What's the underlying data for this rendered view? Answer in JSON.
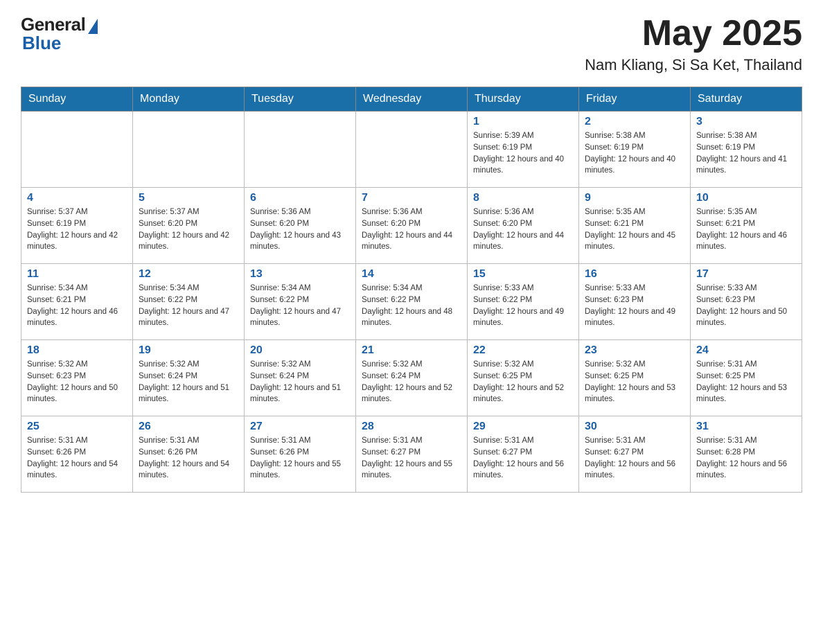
{
  "header": {
    "logo_general": "General",
    "logo_blue": "Blue",
    "month_year": "May 2025",
    "location": "Nam Kliang, Si Sa Ket, Thailand"
  },
  "days_of_week": [
    "Sunday",
    "Monday",
    "Tuesday",
    "Wednesday",
    "Thursday",
    "Friday",
    "Saturday"
  ],
  "weeks": [
    [
      {
        "day": "",
        "sunrise": "",
        "sunset": "",
        "daylight": ""
      },
      {
        "day": "",
        "sunrise": "",
        "sunset": "",
        "daylight": ""
      },
      {
        "day": "",
        "sunrise": "",
        "sunset": "",
        "daylight": ""
      },
      {
        "day": "",
        "sunrise": "",
        "sunset": "",
        "daylight": ""
      },
      {
        "day": "1",
        "sunrise": "Sunrise: 5:39 AM",
        "sunset": "Sunset: 6:19 PM",
        "daylight": "Daylight: 12 hours and 40 minutes."
      },
      {
        "day": "2",
        "sunrise": "Sunrise: 5:38 AM",
        "sunset": "Sunset: 6:19 PM",
        "daylight": "Daylight: 12 hours and 40 minutes."
      },
      {
        "day": "3",
        "sunrise": "Sunrise: 5:38 AM",
        "sunset": "Sunset: 6:19 PM",
        "daylight": "Daylight: 12 hours and 41 minutes."
      }
    ],
    [
      {
        "day": "4",
        "sunrise": "Sunrise: 5:37 AM",
        "sunset": "Sunset: 6:19 PM",
        "daylight": "Daylight: 12 hours and 42 minutes."
      },
      {
        "day": "5",
        "sunrise": "Sunrise: 5:37 AM",
        "sunset": "Sunset: 6:20 PM",
        "daylight": "Daylight: 12 hours and 42 minutes."
      },
      {
        "day": "6",
        "sunrise": "Sunrise: 5:36 AM",
        "sunset": "Sunset: 6:20 PM",
        "daylight": "Daylight: 12 hours and 43 minutes."
      },
      {
        "day": "7",
        "sunrise": "Sunrise: 5:36 AM",
        "sunset": "Sunset: 6:20 PM",
        "daylight": "Daylight: 12 hours and 44 minutes."
      },
      {
        "day": "8",
        "sunrise": "Sunrise: 5:36 AM",
        "sunset": "Sunset: 6:20 PM",
        "daylight": "Daylight: 12 hours and 44 minutes."
      },
      {
        "day": "9",
        "sunrise": "Sunrise: 5:35 AM",
        "sunset": "Sunset: 6:21 PM",
        "daylight": "Daylight: 12 hours and 45 minutes."
      },
      {
        "day": "10",
        "sunrise": "Sunrise: 5:35 AM",
        "sunset": "Sunset: 6:21 PM",
        "daylight": "Daylight: 12 hours and 46 minutes."
      }
    ],
    [
      {
        "day": "11",
        "sunrise": "Sunrise: 5:34 AM",
        "sunset": "Sunset: 6:21 PM",
        "daylight": "Daylight: 12 hours and 46 minutes."
      },
      {
        "day": "12",
        "sunrise": "Sunrise: 5:34 AM",
        "sunset": "Sunset: 6:22 PM",
        "daylight": "Daylight: 12 hours and 47 minutes."
      },
      {
        "day": "13",
        "sunrise": "Sunrise: 5:34 AM",
        "sunset": "Sunset: 6:22 PM",
        "daylight": "Daylight: 12 hours and 47 minutes."
      },
      {
        "day": "14",
        "sunrise": "Sunrise: 5:34 AM",
        "sunset": "Sunset: 6:22 PM",
        "daylight": "Daylight: 12 hours and 48 minutes."
      },
      {
        "day": "15",
        "sunrise": "Sunrise: 5:33 AM",
        "sunset": "Sunset: 6:22 PM",
        "daylight": "Daylight: 12 hours and 49 minutes."
      },
      {
        "day": "16",
        "sunrise": "Sunrise: 5:33 AM",
        "sunset": "Sunset: 6:23 PM",
        "daylight": "Daylight: 12 hours and 49 minutes."
      },
      {
        "day": "17",
        "sunrise": "Sunrise: 5:33 AM",
        "sunset": "Sunset: 6:23 PM",
        "daylight": "Daylight: 12 hours and 50 minutes."
      }
    ],
    [
      {
        "day": "18",
        "sunrise": "Sunrise: 5:32 AM",
        "sunset": "Sunset: 6:23 PM",
        "daylight": "Daylight: 12 hours and 50 minutes."
      },
      {
        "day": "19",
        "sunrise": "Sunrise: 5:32 AM",
        "sunset": "Sunset: 6:24 PM",
        "daylight": "Daylight: 12 hours and 51 minutes."
      },
      {
        "day": "20",
        "sunrise": "Sunrise: 5:32 AM",
        "sunset": "Sunset: 6:24 PM",
        "daylight": "Daylight: 12 hours and 51 minutes."
      },
      {
        "day": "21",
        "sunrise": "Sunrise: 5:32 AM",
        "sunset": "Sunset: 6:24 PM",
        "daylight": "Daylight: 12 hours and 52 minutes."
      },
      {
        "day": "22",
        "sunrise": "Sunrise: 5:32 AM",
        "sunset": "Sunset: 6:25 PM",
        "daylight": "Daylight: 12 hours and 52 minutes."
      },
      {
        "day": "23",
        "sunrise": "Sunrise: 5:32 AM",
        "sunset": "Sunset: 6:25 PM",
        "daylight": "Daylight: 12 hours and 53 minutes."
      },
      {
        "day": "24",
        "sunrise": "Sunrise: 5:31 AM",
        "sunset": "Sunset: 6:25 PM",
        "daylight": "Daylight: 12 hours and 53 minutes."
      }
    ],
    [
      {
        "day": "25",
        "sunrise": "Sunrise: 5:31 AM",
        "sunset": "Sunset: 6:26 PM",
        "daylight": "Daylight: 12 hours and 54 minutes."
      },
      {
        "day": "26",
        "sunrise": "Sunrise: 5:31 AM",
        "sunset": "Sunset: 6:26 PM",
        "daylight": "Daylight: 12 hours and 54 minutes."
      },
      {
        "day": "27",
        "sunrise": "Sunrise: 5:31 AM",
        "sunset": "Sunset: 6:26 PM",
        "daylight": "Daylight: 12 hours and 55 minutes."
      },
      {
        "day": "28",
        "sunrise": "Sunrise: 5:31 AM",
        "sunset": "Sunset: 6:27 PM",
        "daylight": "Daylight: 12 hours and 55 minutes."
      },
      {
        "day": "29",
        "sunrise": "Sunrise: 5:31 AM",
        "sunset": "Sunset: 6:27 PM",
        "daylight": "Daylight: 12 hours and 56 minutes."
      },
      {
        "day": "30",
        "sunrise": "Sunrise: 5:31 AM",
        "sunset": "Sunset: 6:27 PM",
        "daylight": "Daylight: 12 hours and 56 minutes."
      },
      {
        "day": "31",
        "sunrise": "Sunrise: 5:31 AM",
        "sunset": "Sunset: 6:28 PM",
        "daylight": "Daylight: 12 hours and 56 minutes."
      }
    ]
  ]
}
